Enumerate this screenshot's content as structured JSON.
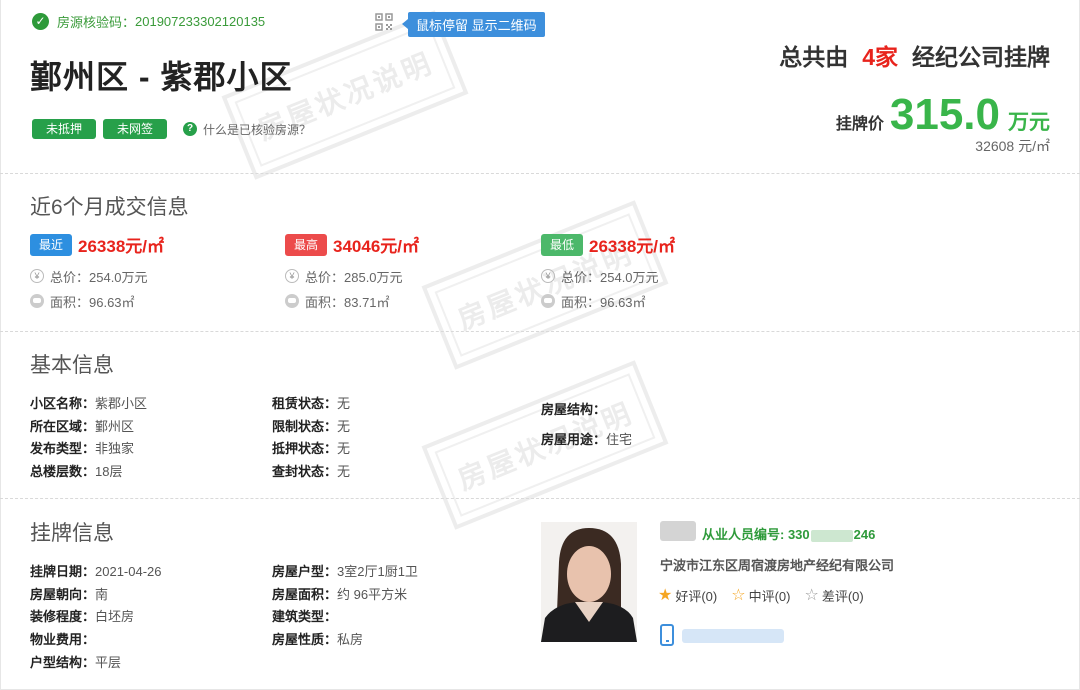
{
  "header": {
    "verify_label": "房源核验码：",
    "verify_code": "201907233302120135",
    "qr_tip": "鼠标停留 显示二维码",
    "title": "鄞州区 - 紫郡小区",
    "tags": [
      "未抵押",
      "未网签"
    ],
    "help_text": "什么是已核验房源？",
    "agency_prefix": "总共由",
    "agency_count": "4家",
    "agency_suffix": "经纪公司挂牌",
    "price_label": "挂牌价",
    "price_value": "315.0",
    "price_unit": "万元",
    "unit_price": "32608 元/㎡",
    "watermark": "房屋状况说明"
  },
  "deals": {
    "title": "近6个月成交信息",
    "items": [
      {
        "badge": "最近",
        "color": "#2d8fe0",
        "price": "26338元/㎡",
        "total": "总价：254.0万元",
        "area": "面积：96.63㎡"
      },
      {
        "badge": "最高",
        "color": "#ec4b4b",
        "price": "34046元/㎡",
        "total": "总价：285.0万元",
        "area": "面积：83.71㎡"
      },
      {
        "badge": "最低",
        "color": "#4cb86a",
        "price": "26338元/㎡",
        "total": "总价：254.0万元",
        "area": "面积：96.63㎡"
      }
    ]
  },
  "basic": {
    "title": "基本信息",
    "col1": [
      {
        "k": "小区名称：",
        "v": "紫郡小区"
      },
      {
        "k": "所在区域：",
        "v": "鄞州区"
      },
      {
        "k": "发布类型：",
        "v": "非独家"
      },
      {
        "k": "总楼层数：",
        "v": "18层"
      }
    ],
    "col2": [
      {
        "k": "租赁状态：",
        "v": "无"
      },
      {
        "k": "限制状态：",
        "v": "无"
      },
      {
        "k": "抵押状态：",
        "v": "无"
      },
      {
        "k": "查封状态：",
        "v": "无"
      }
    ],
    "col3": [
      {
        "k": "房屋结构：",
        "v": ""
      },
      {
        "k": "房屋用途：",
        "v": "住宅"
      }
    ]
  },
  "listing": {
    "title": "挂牌信息",
    "col1": [
      {
        "k": "挂牌日期：",
        "v": "2021-04-26"
      },
      {
        "k": "房屋朝向：",
        "v": "南"
      },
      {
        "k": "装修程度：",
        "v": "白坯房"
      },
      {
        "k": "物业费用：",
        "v": ""
      },
      {
        "k": "户型结构：",
        "v": "平层"
      }
    ],
    "col2": [
      {
        "k": "房屋户型：",
        "v": "3室2厅1厨1卫"
      },
      {
        "k": "房屋面积：",
        "v": "约 96平方米"
      },
      {
        "k": "建筑类型：",
        "v": ""
      },
      {
        "k": "房屋性质：",
        "v": "私房"
      }
    ]
  },
  "agent": {
    "id_label": "从业人员编号: 330",
    "id_tail": "246",
    "company": "宁波市江东区周宿渡房地产经纪有限公司",
    "good": "好评(0)",
    "mid": "中评(0)",
    "bad": "差评(0)",
    "good_color": "#f5a623"
  }
}
